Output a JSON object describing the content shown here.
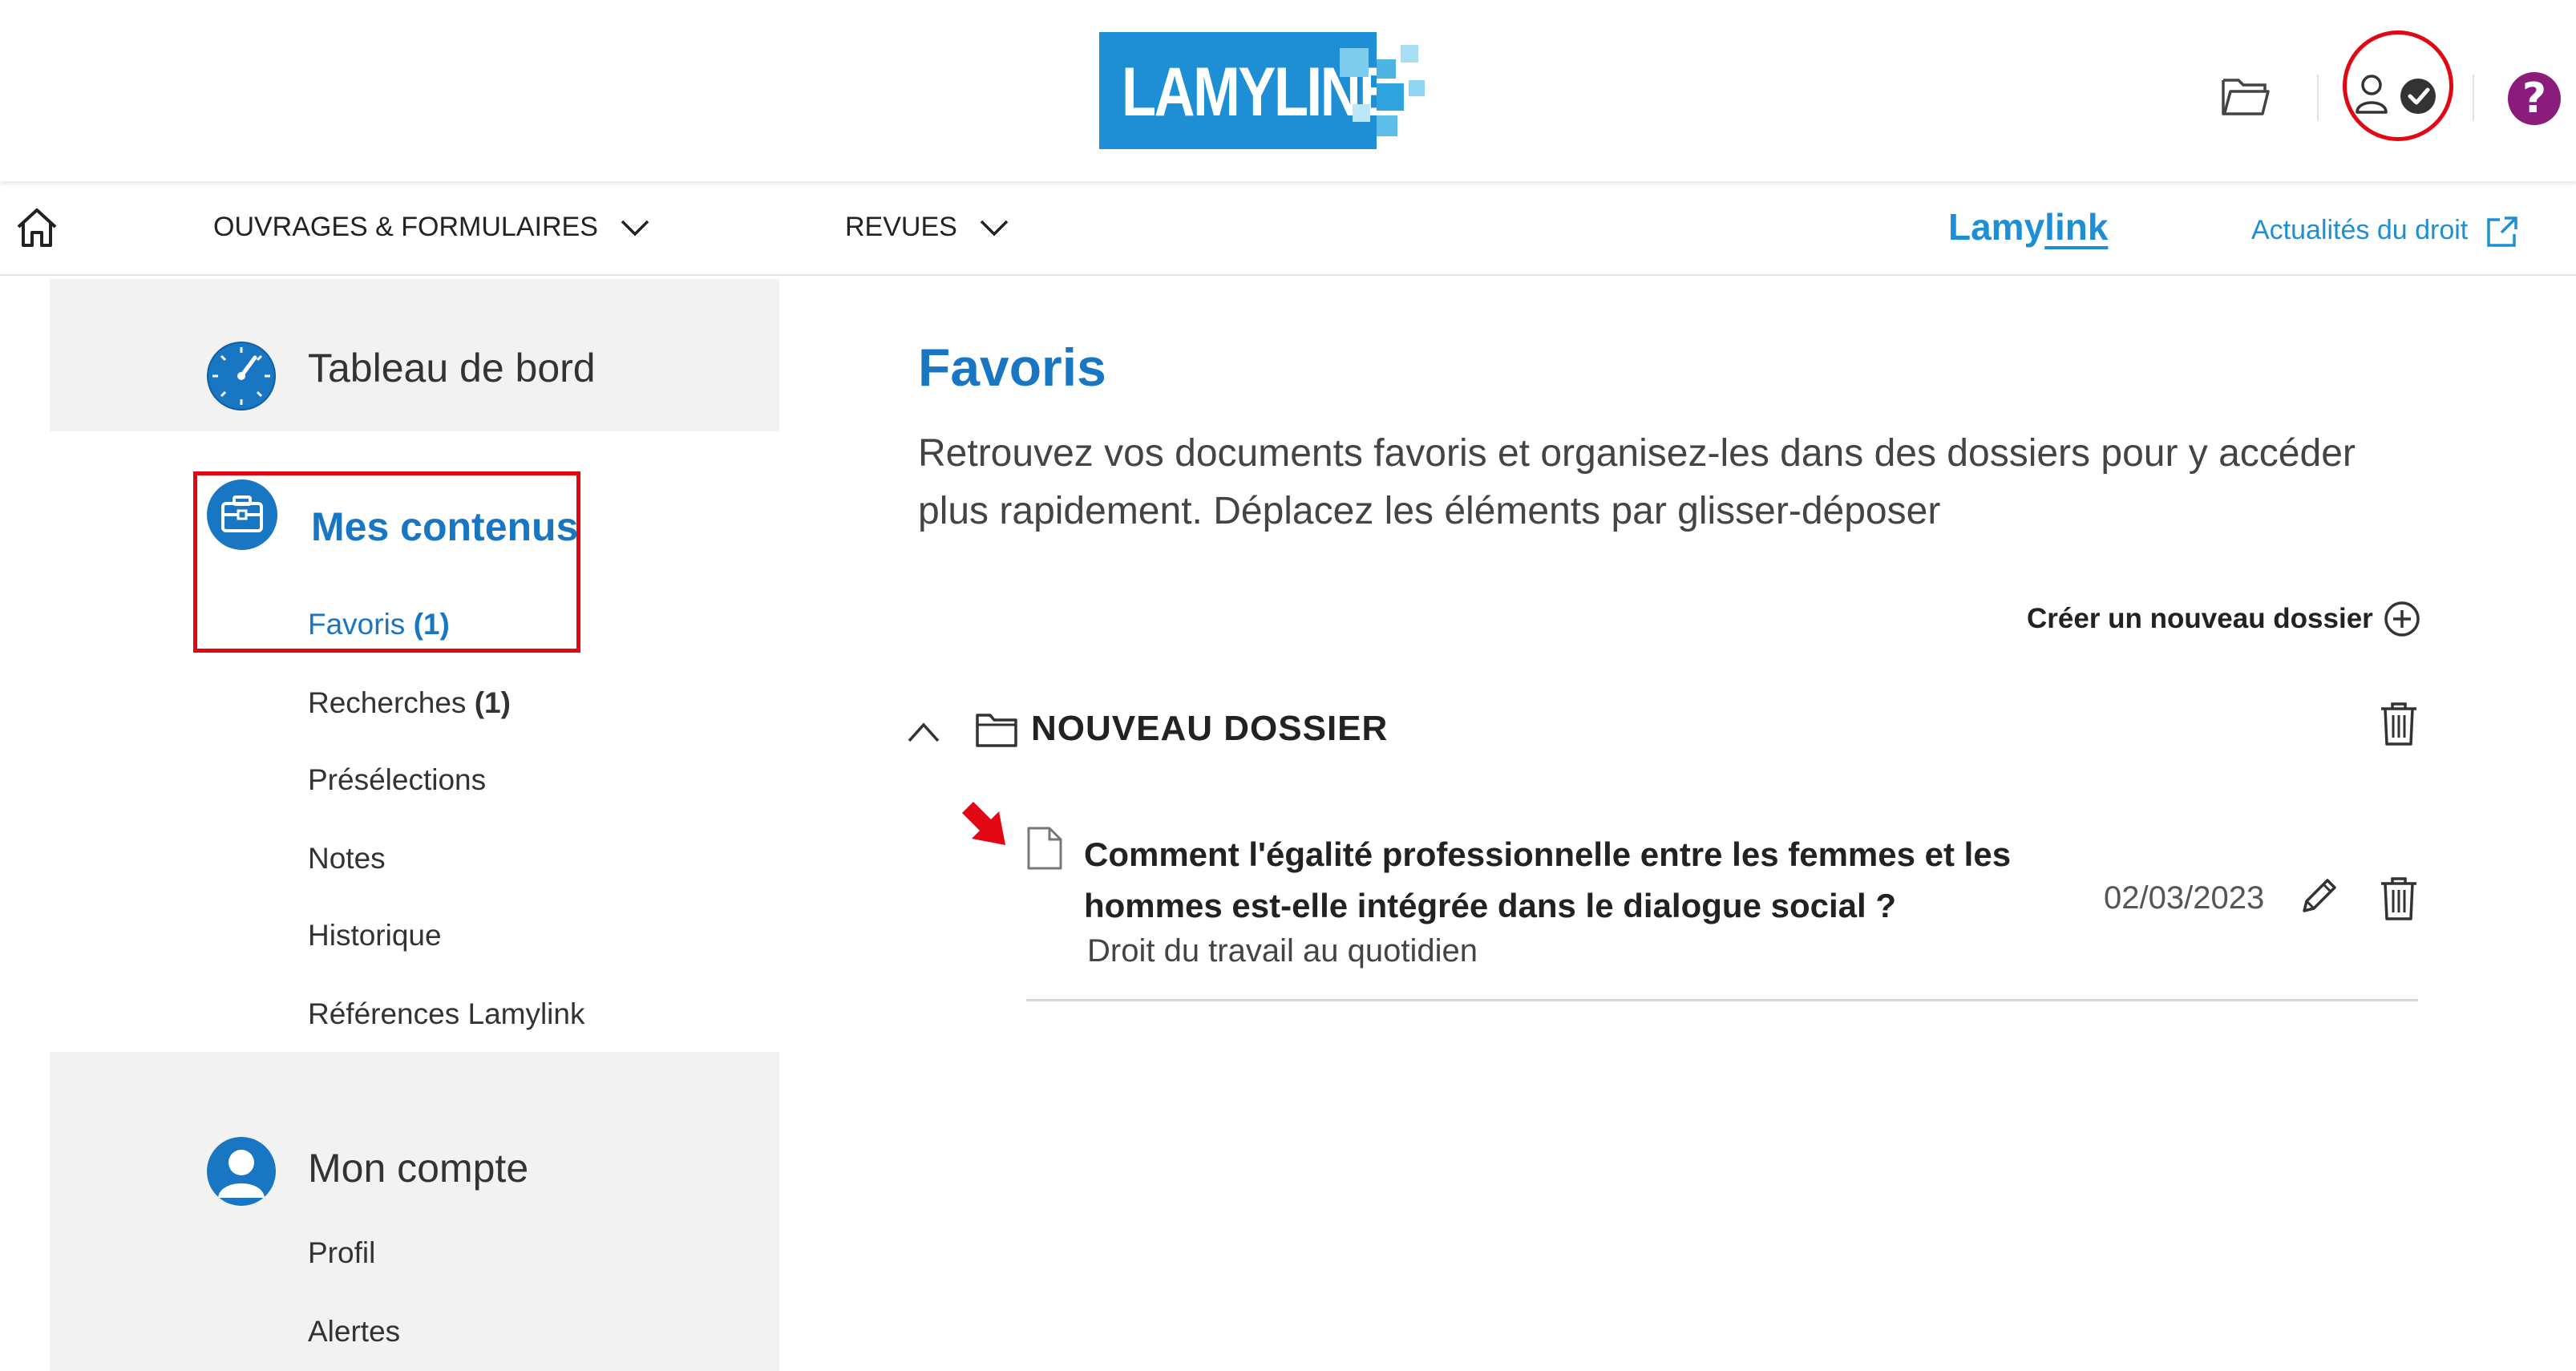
{
  "header": {
    "logo_text": "LAMYLINE",
    "icons": [
      "folder-icon",
      "user-check-icon",
      "help-icon"
    ],
    "help_symbol": "?"
  },
  "nav": {
    "home_icon": "home-icon",
    "items": [
      {
        "label": "OUVRAGES & FORMULAIRES"
      },
      {
        "label": "REVUES"
      }
    ],
    "lamylink_prefix": "Lamy",
    "lamylink_suffix": "link",
    "actualites": "Actualités du droit"
  },
  "sidebar": {
    "dashboard": "Tableau de bord",
    "my_contents": {
      "title": "Mes contenus",
      "items": [
        {
          "label": "Favoris",
          "count": "(1)"
        },
        {
          "label": "Recherches",
          "count": "(1)"
        },
        {
          "label": "Présélections",
          "count": ""
        },
        {
          "label": "Notes",
          "count": ""
        },
        {
          "label": "Historique",
          "count": ""
        },
        {
          "label": "Références Lamylink",
          "count": ""
        }
      ]
    },
    "account": {
      "title": "Mon compte",
      "items": [
        {
          "label": "Profil"
        },
        {
          "label": "Alertes"
        }
      ]
    }
  },
  "main": {
    "title": "Favoris",
    "intro": "Retrouvez vos documents favoris et organisez-les dans des dossiers pour y accéder plus rapidement. Déplacez les éléments par glisser-déposer",
    "create_folder": "Créer un nouveau dossier",
    "folder": {
      "name": "NOUVEAU DOSSIER",
      "documents": [
        {
          "title": "Comment l'égalité professionnelle entre les femmes et les hommes est-elle intégrée dans le dialogue social ?",
          "source": "Droit du travail au quotidien",
          "date": "02/03/2023"
        }
      ]
    }
  },
  "colors": {
    "brand_blue": "#1e8fd4",
    "title_blue": "#1976c2",
    "annotation_red": "#e30613",
    "help_purple": "#8a1c7c"
  }
}
